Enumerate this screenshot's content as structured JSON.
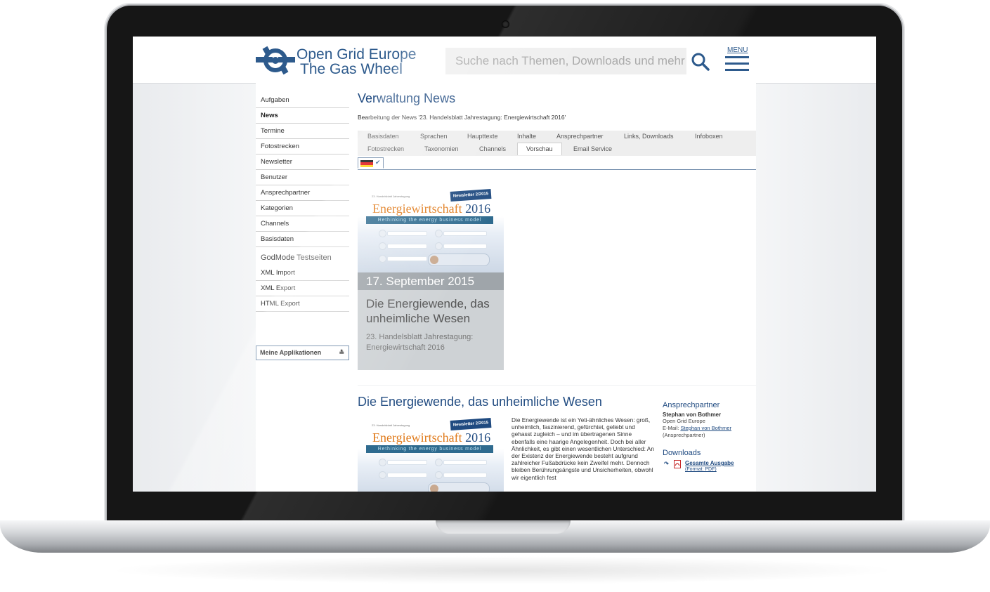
{
  "site": {
    "logo_title": "Open Grid Europe",
    "logo_subtitle": "The Gas Wheel",
    "search_placeholder": "Suche nach Themen, Downloads und mehr",
    "menu_label": "MENU",
    "brand_color": "#2d5a8c"
  },
  "sidebar": {
    "items": [
      {
        "label": "Aufgaben",
        "bold": false
      },
      {
        "label": "News",
        "bold": true
      },
      {
        "label": "Termine",
        "bold": false
      },
      {
        "label": "Fotostrecken",
        "bold": false
      },
      {
        "label": "Newsletter",
        "bold": false
      },
      {
        "label": "Benutzer",
        "bold": false
      },
      {
        "label": "Ansprechpartner",
        "bold": false
      },
      {
        "label": "Kategorien",
        "bold": false
      },
      {
        "label": "Channels",
        "bold": false
      },
      {
        "label": "Basisdaten",
        "bold": false
      }
    ],
    "group_title": "GodMode Testseiten",
    "group_items": [
      "XML Import",
      "XML Export",
      "HTML Export"
    ],
    "apps_select": "Meine Applikationen"
  },
  "main": {
    "title": "Verwaltung News",
    "subtitle": "Bearbeitung der News '23. Handelsblatt Jahrestagung: Energiewirtschaft 2016'",
    "tabs_row1": [
      "Basisdaten",
      "Sprachen",
      "Haupttexte",
      "Inhalte",
      "Ansprechpartner",
      "Links, Downloads",
      "Infoboxen"
    ],
    "tabs_row2": [
      "Fotostrecken",
      "Taxonomien",
      "Channels",
      "Vorschau",
      "Email Service"
    ],
    "active_tab": "Vorschau",
    "language_check": "✔"
  },
  "thumbnail": {
    "badge": "Newsletter 2/2015",
    "caption": "23. Handelsblatt Jahrestagung",
    "title_word": "Energiewirtschaft",
    "title_year": "2016",
    "strip": "Rethinking the energy business model"
  },
  "preview_card": {
    "date": "17. September 2015",
    "headline": "Die Energiewende, das unheimliche Wesen",
    "subline": "23. Handelsblatt Jahrestagung: Energiewirtschaft 2016"
  },
  "article": {
    "title": "Die Energiewende, das unheimliche Wesen",
    "body": "Die Energiewende ist ein Yeti-ähnliches Wesen: groß, unheimlich, faszinierend, gefürchtet, geliebt und gehasst zugleich – und im übertragenen Sinne ebenfalls eine haarige Angelegenheit. Doch bei aller Ähnlichkeit, es gibt einen wesentlichen Unterschied: An der Existenz der Energiewende besteht aufgrund zahlreicher Fußabdrücke kein Zweifel mehr. Dennoch bleiben Berührungsängste und Unsicherheiten, obwohl wir eigentlich fest"
  },
  "contact": {
    "heading": "Ansprechpartner",
    "name": "Stephan von Bothmer",
    "company": "Open Grid Europe",
    "email_prefix": "E-Mail:",
    "email_link": "Stephan von Bothmer",
    "role": "(Ansprechpartner)"
  },
  "downloads": {
    "heading": "Downloads",
    "item_label": "Gesamte Ausgabe",
    "item_format": "(Format: PDF)"
  }
}
